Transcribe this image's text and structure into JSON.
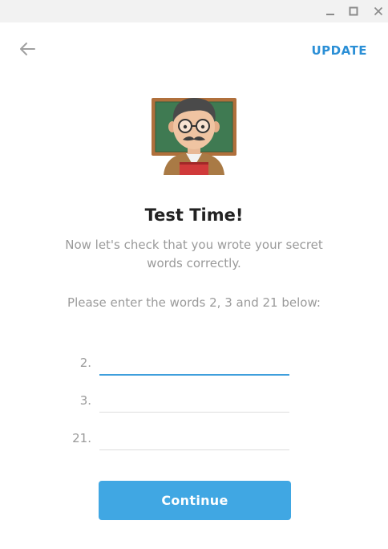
{
  "window": {
    "controls": [
      "minimize-icon",
      "maximize-icon",
      "close-icon"
    ]
  },
  "header": {
    "back_icon": "arrow-left-icon",
    "update_label": "UPDATE"
  },
  "illustration": {
    "icon": "teacher-emoji"
  },
  "content": {
    "title": "Test Time!",
    "subtitle": "Now let's check that you wrote your secret words correctly.",
    "instruction": "Please enter the words 2, 3 and 21 below:"
  },
  "fields": [
    {
      "number": "2.",
      "value": "",
      "placeholder": ""
    },
    {
      "number": "3.",
      "value": "",
      "placeholder": ""
    },
    {
      "number": "21.",
      "value": "",
      "placeholder": ""
    }
  ],
  "actions": {
    "continue_label": "Continue"
  },
  "colors": {
    "accent": "#40a7e3",
    "link": "#2b8fd6",
    "muted_text": "#9a9a9a"
  }
}
